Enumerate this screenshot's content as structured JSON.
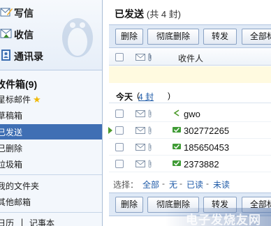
{
  "sidebar": {
    "actions": {
      "compose": "写信",
      "receive": "收信",
      "contacts": "通讯录"
    },
    "folder_header": "收件箱(9)",
    "folders": {
      "starred": "星标邮件",
      "drafts": "草稿箱",
      "sent": "已发送",
      "deleted": "已删除",
      "spam": "垃圾箱"
    },
    "my_folders": "我的文件夹",
    "other_mailboxes": "其他邮箱",
    "bottom_links": {
      "left": "日历",
      "sep": "|",
      "notes": "记事本"
    }
  },
  "main": {
    "title": "已发送",
    "count_label": "(共 4 封)",
    "toolbar": {
      "delete": "删除",
      "delete_permanently": "彻底删除",
      "forward": "转发",
      "mark_all": "全部标"
    },
    "columns": {
      "recipient": "收件人"
    },
    "today_group": {
      "label": "今天",
      "open_paren": "(",
      "count": "4 封",
      "close_paren": ")"
    },
    "rows": [
      {
        "recipient": "gwo"
      },
      {
        "recipient": "302772265"
      },
      {
        "recipient": "185650453"
      },
      {
        "recipient": "2373882"
      }
    ],
    "select": {
      "label": "选择：",
      "all": "全部",
      "none": "无",
      "read": "已读",
      "unread": "未读",
      "dash": "-"
    }
  },
  "watermark": "电子发烧友网",
  "colors": {
    "selected_folder": "#3f6fb4",
    "link": "#1f5ba8",
    "toolbar_bg": "#dfe9f6",
    "notice_bg": "#fffae0"
  }
}
